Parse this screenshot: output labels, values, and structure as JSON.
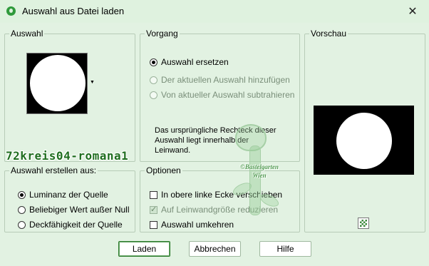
{
  "window": {
    "title": "Auswahl aus Datei laden",
    "close_symbol": "✕"
  },
  "auswahl": {
    "legend": "Auswahl",
    "watermark_name": "72kreis04-romana1"
  },
  "vorgang": {
    "legend": "Vorgang",
    "options": [
      {
        "label": "Auswahl ersetzen",
        "selected": true,
        "enabled": true
      },
      {
        "label": "Der aktuellen Auswahl hinzufügen",
        "selected": false,
        "enabled": false
      },
      {
        "label": "Von aktueller Auswahl subtrahieren",
        "selected": false,
        "enabled": false
      }
    ],
    "note": "Das ursprüngliche Rechteck dieser Auswahl liegt innerhalb der Leinwand."
  },
  "vorschau": {
    "legend": "Vorschau"
  },
  "erstellen": {
    "legend": "Auswahl erstellen aus:",
    "options": [
      {
        "label": "Luminanz der Quelle",
        "selected": true
      },
      {
        "label": "Beliebiger Wert außer Null",
        "selected": false
      },
      {
        "label": "Deckfähigkeit der Quelle",
        "selected": false
      }
    ]
  },
  "optionen": {
    "legend": "Optionen",
    "checks": [
      {
        "label": "In obere linke Ecke verschieben",
        "checked": false,
        "enabled": true
      },
      {
        "label": "Auf Leinwandgröße reduzieren",
        "checked": true,
        "enabled": false
      },
      {
        "label": "Auswahl umkehren",
        "checked": false,
        "enabled": true
      }
    ]
  },
  "watermark": {
    "line1": "©Bastelgarten",
    "line2": "Wien"
  },
  "buttons": {
    "load": "Laden",
    "cancel": "Abbrechen",
    "help": "Hilfe"
  },
  "colors": {
    "window_bg": "#e2f2e2",
    "titlebar_bg": "#dff2df",
    "accent": "#2f7d2f"
  }
}
